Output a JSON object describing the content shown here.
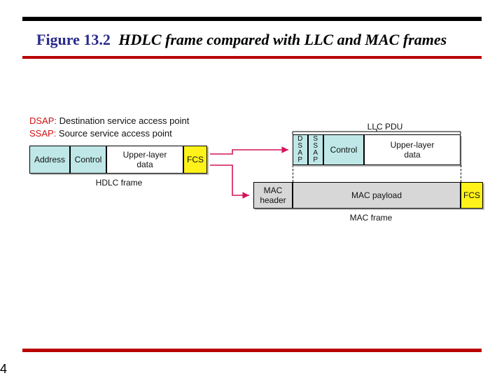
{
  "title": {
    "fig": "Figure 13.2",
    "desc": "HDLC frame compared with LLC and MAC frames"
  },
  "defs": {
    "dsap_key": "DSAP:",
    "dsap_val": "Destination service access point",
    "ssap_key": "SSAP:",
    "ssap_val": "Source service access point"
  },
  "hdlc": {
    "address": "Address",
    "control": "Control",
    "data": "Upper-layer\ndata",
    "fcs": "FCS",
    "label": "HDLC frame"
  },
  "llc": {
    "dsap": "D\nS\nA\nP",
    "ssap": "S\nS\nA\nP",
    "control": "Control",
    "data": "Upper-layer\ndata",
    "label": "LLC PDU"
  },
  "mac": {
    "header": "MAC\nheader",
    "payload": "MAC payload",
    "fcs": "FCS",
    "label": "MAC frame"
  },
  "pagenum": "4"
}
